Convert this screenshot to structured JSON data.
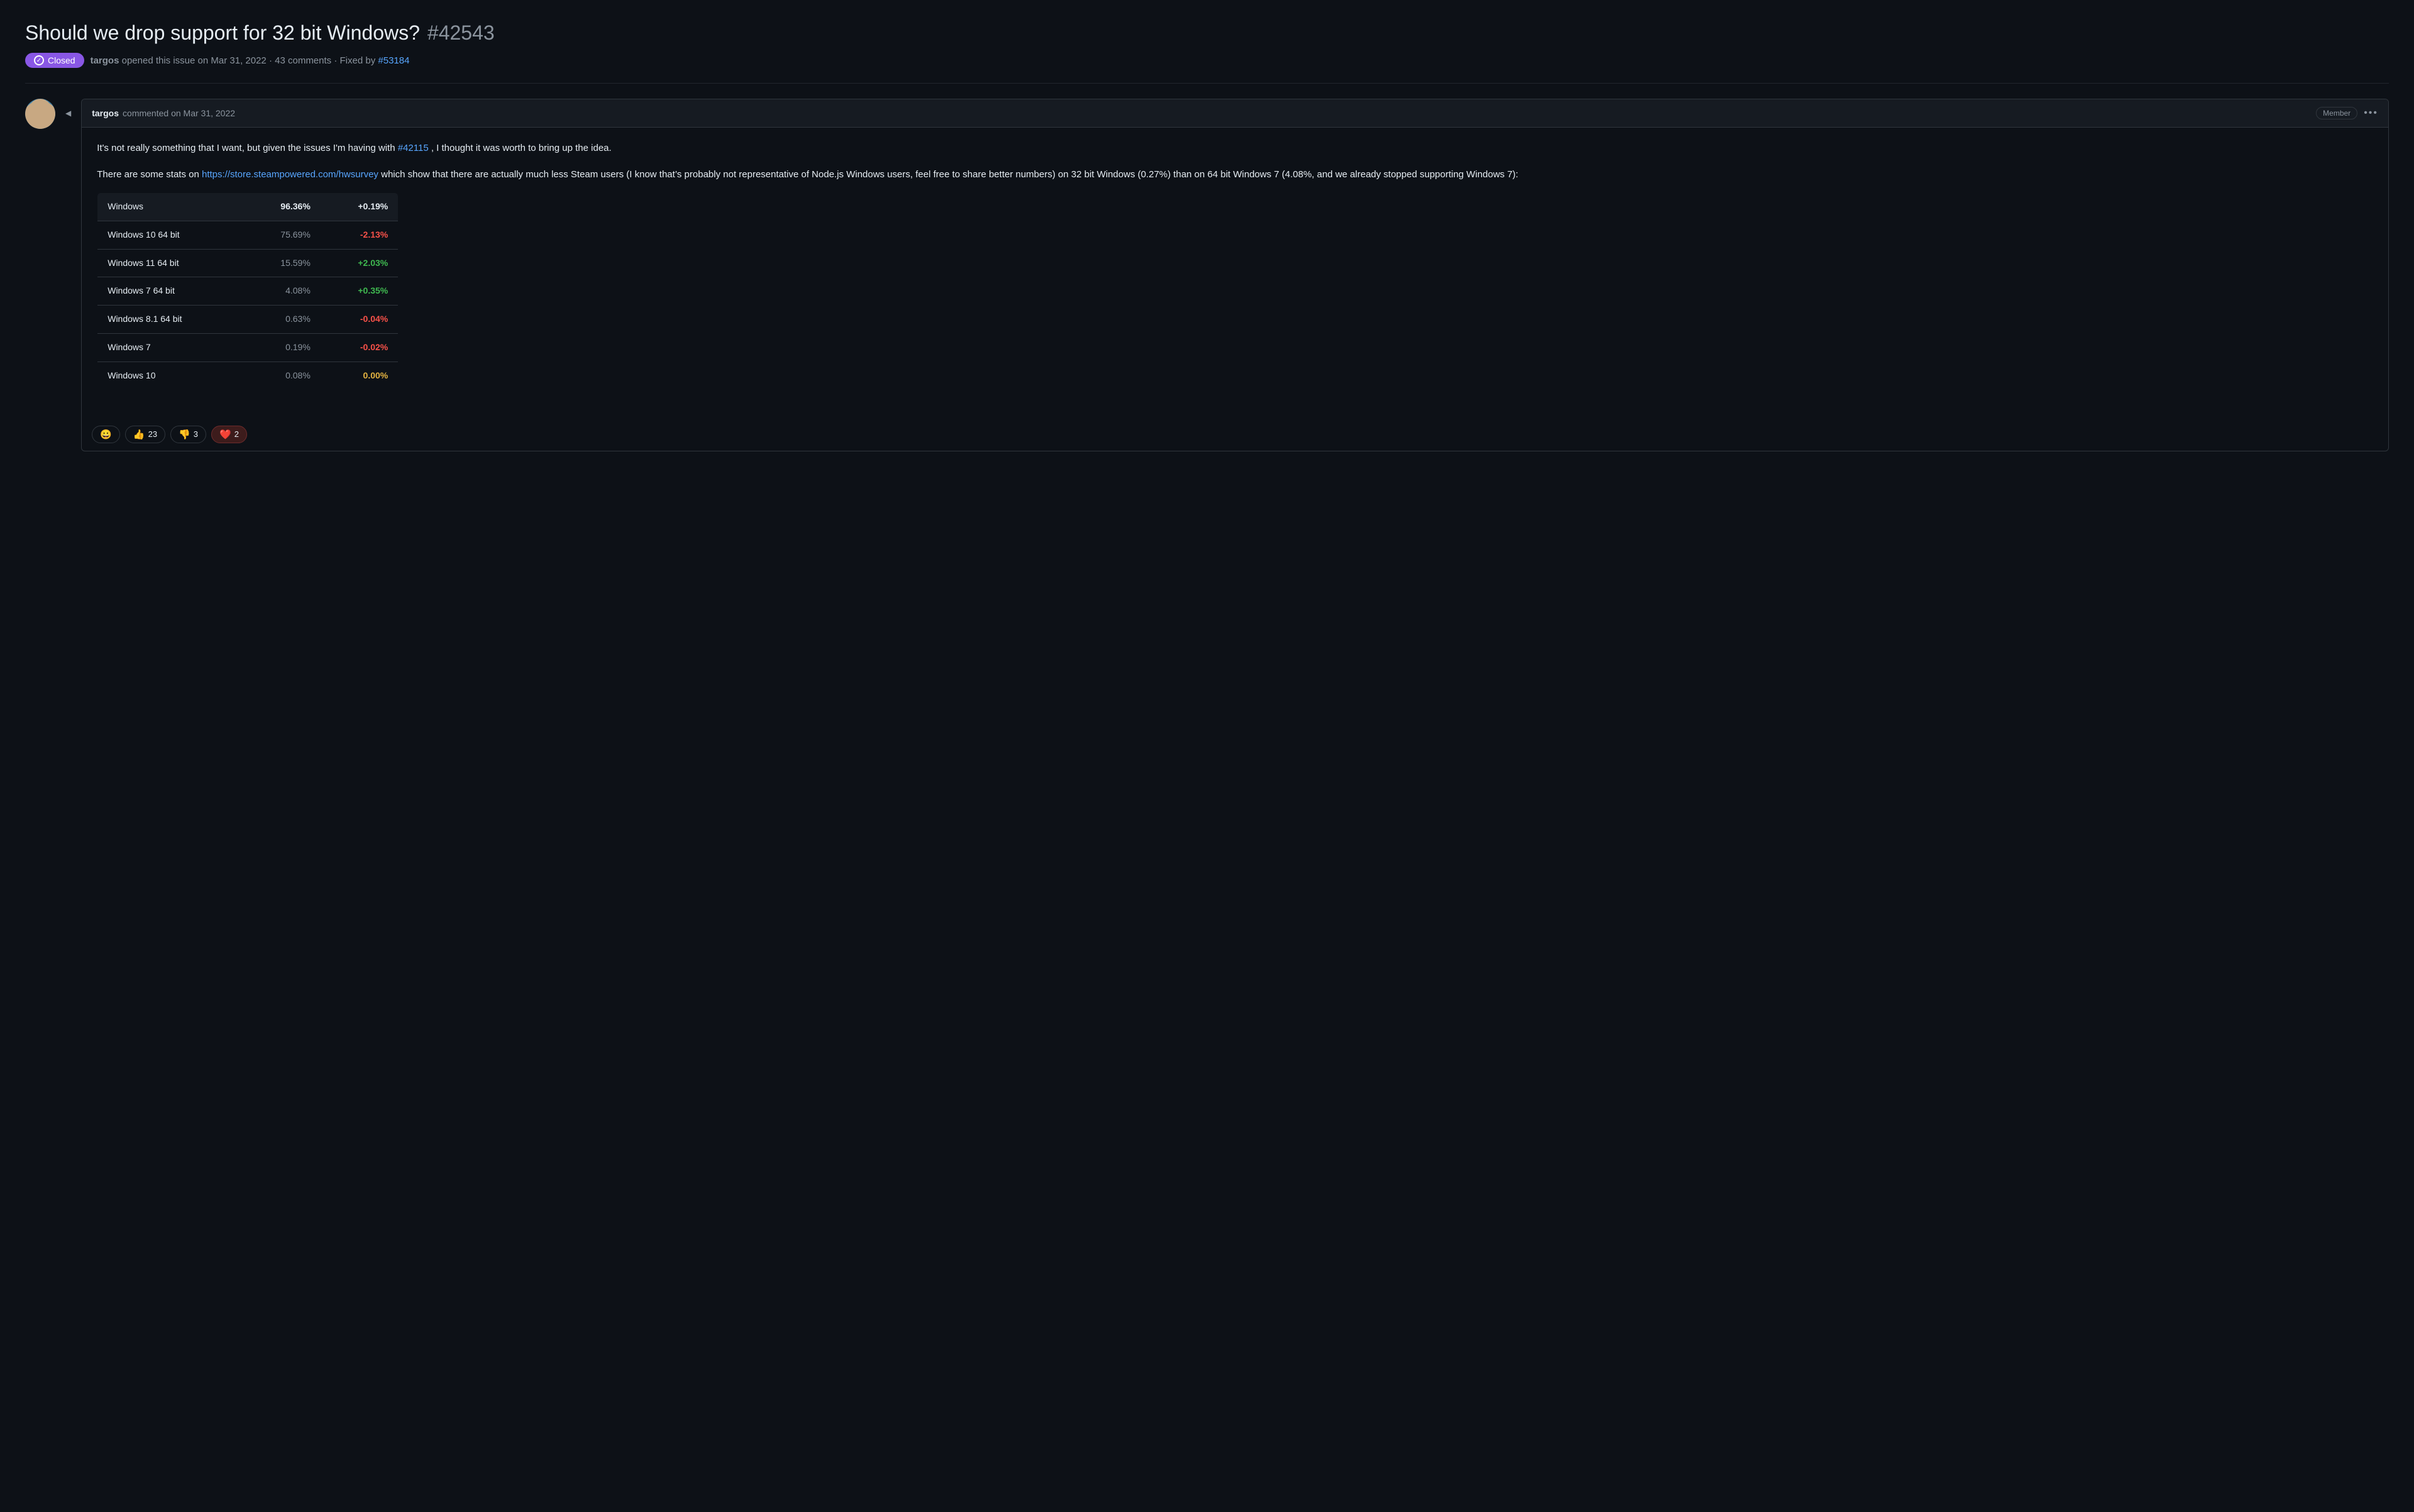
{
  "issue": {
    "title": "Should we drop support for 32 bit Windows?",
    "number": "#42543",
    "status": "Closed",
    "author": "targos",
    "opened_date": "Mar 31, 2022",
    "comments_count": "43 comments",
    "fixed_by_label": "Fixed by",
    "fixed_by_ref": "#53184"
  },
  "comment": {
    "author": "targos",
    "date": "Mar 31, 2022",
    "action": "commented on",
    "member_badge": "Member",
    "body_p1": "It's not really something that I want, but given the issues I'm having with",
    "issue_ref": "#42115",
    "body_p1_suffix": ", I thought it was worth to bring up the idea.",
    "body_p2_prefix": "There are some stats on",
    "stats_link": "https://store.steampowered.com/hwsurvey",
    "body_p2_suffix": "which show that there are actually much less Steam users (I know that’s probably not representative of Node.js Windows users, feel free to share better numbers) on 32 bit Windows (0.27%) than on 64 bit Windows 7 (4.08%, and we already stopped supporting Windows 7):",
    "more_options": "•••"
  },
  "table": {
    "headers": [
      "Windows",
      "96.36%",
      "+0.19%"
    ],
    "rows": [
      {
        "name": "Windows 10 64 bit",
        "percent": "75.69%",
        "change": "-2.13%",
        "change_type": "negative"
      },
      {
        "name": "Windows 11 64 bit",
        "percent": "15.59%",
        "change": "+2.03%",
        "change_type": "positive"
      },
      {
        "name": "Windows 7 64 bit",
        "percent": "4.08%",
        "change": "+0.35%",
        "change_type": "positive"
      },
      {
        "name": "Windows 8.1 64 bit",
        "percent": "0.63%",
        "change": "-0.04%",
        "change_type": "negative"
      },
      {
        "name": "Windows 7",
        "percent": "0.19%",
        "change": "-0.02%",
        "change_type": "negative"
      },
      {
        "name": "Windows 10",
        "percent": "0.08%",
        "change": "0.00%",
        "change_type": "neutral"
      }
    ]
  },
  "reactions": [
    {
      "emoji": "😀",
      "label": "smiley",
      "count": null,
      "type": "smiley"
    },
    {
      "emoji": "👍",
      "label": "thumbs-up",
      "count": "23",
      "type": "thumbs-up"
    },
    {
      "emoji": "👎",
      "label": "thumbs-down",
      "count": "3",
      "type": "thumbs-down"
    },
    {
      "emoji": "❤️",
      "label": "heart",
      "count": "2",
      "type": "heart"
    }
  ],
  "colors": {
    "bg": "#0d1117",
    "surface": "#161b22",
    "border": "#30363d",
    "text_primary": "#e6edf3",
    "text_muted": "#8b949e",
    "accent": "#58a6ff",
    "status_purple": "#8957e5",
    "positive": "#3fb950",
    "negative": "#f85149",
    "neutral": "#e3b341"
  }
}
